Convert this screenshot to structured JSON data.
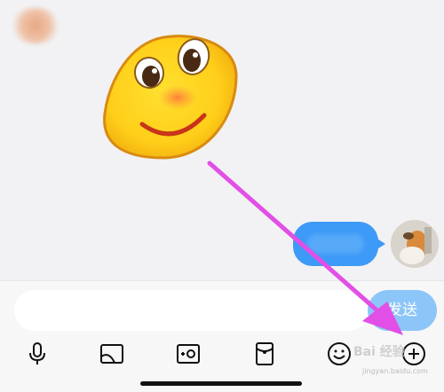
{
  "chat": {
    "incoming_sticker": "smiling-face-sticker",
    "outgoing_message": ""
  },
  "composer": {
    "input_value": "",
    "send_label": "发送"
  },
  "toolbar": {
    "icons": [
      "microphone-icon",
      "image-icon",
      "camera-icon",
      "red-packet-icon",
      "emoji-icon",
      "plus-icon"
    ]
  },
  "watermark": {
    "text": "Bai 经验",
    "sub": "jingyan.baidu.com"
  },
  "colors": {
    "bubble": "#3d9af7",
    "send_button": "#8cc6f9",
    "arrow": "#e14fe6"
  }
}
